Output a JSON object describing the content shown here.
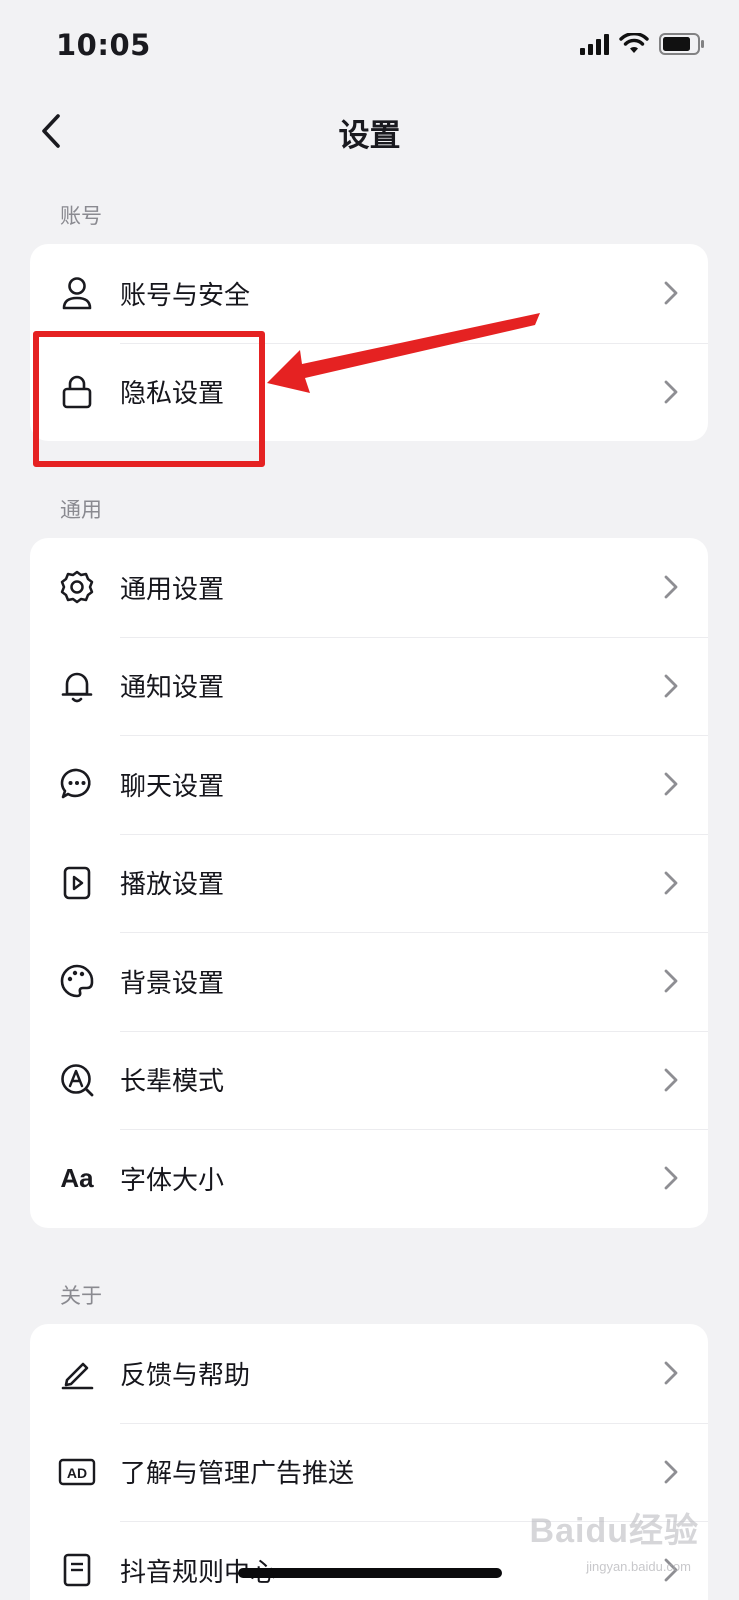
{
  "status_bar": {
    "time": "10:05",
    "icons": [
      "signal-icon",
      "wifi-icon",
      "battery-icon"
    ]
  },
  "nav": {
    "title": "设置",
    "back_icon": "chevron-left-icon"
  },
  "sections": {
    "account": {
      "title": "账号",
      "items": [
        {
          "label": "账号与安全",
          "icon": "user-icon"
        },
        {
          "label": "隐私设置",
          "icon": "lock-icon"
        }
      ]
    },
    "general": {
      "title": "通用",
      "items": [
        {
          "label": "通用设置",
          "icon": "gear-icon"
        },
        {
          "label": "通知设置",
          "icon": "bell-icon"
        },
        {
          "label": "聊天设置",
          "icon": "chat-bubble-icon"
        },
        {
          "label": "播放设置",
          "icon": "play-icon"
        },
        {
          "label": "背景设置",
          "icon": "palette-icon"
        },
        {
          "label": "长辈模式",
          "icon": "elder-mode-icon"
        },
        {
          "label": "字体大小",
          "icon": "font-size-icon",
          "icon_text": "Aa"
        }
      ]
    },
    "about": {
      "title": "关于",
      "items": [
        {
          "label": "反馈与帮助",
          "icon": "pencil-icon"
        },
        {
          "label": "了解与管理广告推送",
          "icon": "ad-icon",
          "icon_text": "AD"
        },
        {
          "label": "抖音规则中心",
          "icon": "document-icon"
        }
      ]
    }
  },
  "annotation": {
    "highlight_color": "#e52222",
    "highlighted_item": "隐私设置"
  },
  "watermark": {
    "text": "Baidu经验",
    "sub": "jingyan.baidu.com"
  },
  "colors": {
    "background": "#f2f2f4",
    "card": "#ffffff",
    "text": "#16161c",
    "section_title": "#8a8a90",
    "chevron": "#8e8e93",
    "annotation_red": "#e52222"
  }
}
